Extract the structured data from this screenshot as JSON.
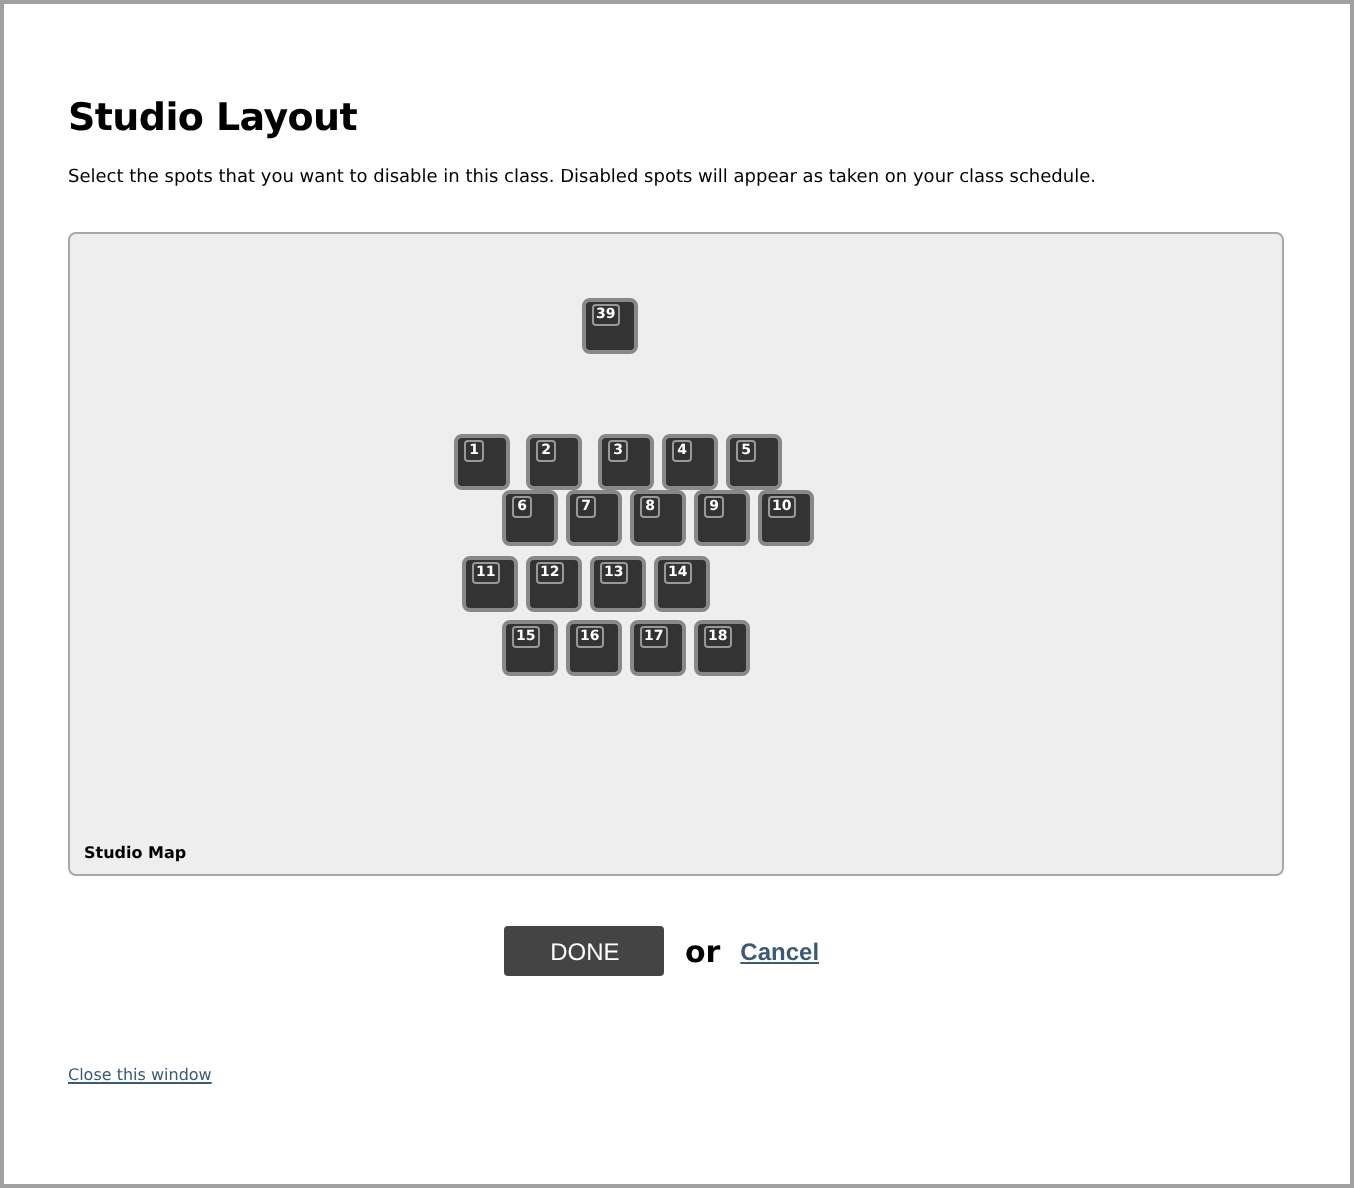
{
  "title": "Studio Layout",
  "instructions": "Select the spots that you want to disable in this class. Disabled spots will appear as taken on your class schedule.",
  "studio_map": {
    "label": "Studio Map",
    "spots": [
      {
        "number": "39"
      },
      {
        "number": "1"
      },
      {
        "number": "2"
      },
      {
        "number": "3"
      },
      {
        "number": "4"
      },
      {
        "number": "5"
      },
      {
        "number": "6"
      },
      {
        "number": "7"
      },
      {
        "number": "8"
      },
      {
        "number": "9"
      },
      {
        "number": "10"
      },
      {
        "number": "11"
      },
      {
        "number": "12"
      },
      {
        "number": "13"
      },
      {
        "number": "14"
      },
      {
        "number": "15"
      },
      {
        "number": "16"
      },
      {
        "number": "17"
      },
      {
        "number": "18"
      }
    ]
  },
  "done_button": "DONE",
  "or_text": "or",
  "cancel_link": "Cancel",
  "close_link": "Close this window"
}
